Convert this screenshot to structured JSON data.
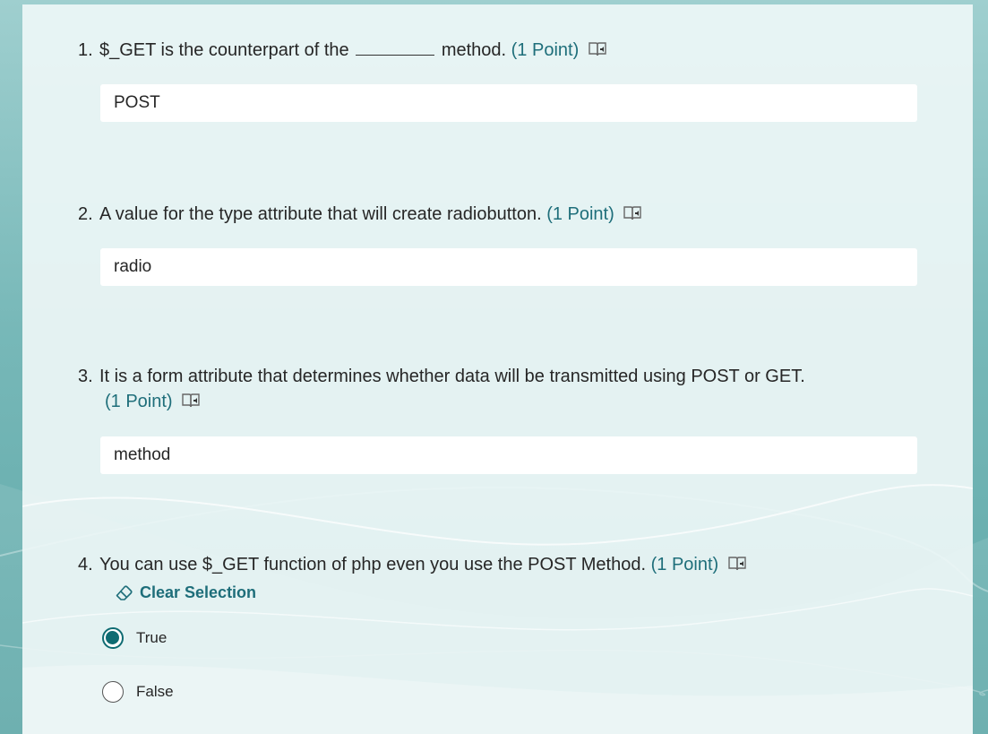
{
  "icons": {
    "read_aloud": "immersive-reader-icon",
    "eraser": "eraser-icon"
  },
  "colors": {
    "accent": "#0f6b72",
    "points": "#1e6e7a",
    "text": "#262626"
  },
  "questions": [
    {
      "number": "1.",
      "text_before": "$_GET is the counterpart of the",
      "text_after": "method.",
      "points": "(1 Point)",
      "answer": "POST"
    },
    {
      "number": "2.",
      "text": "A value for the type attribute that will create radiobutton.",
      "points": "(1 Point)",
      "answer": "radio"
    },
    {
      "number": "3.",
      "text": "It is a form attribute that determines whether data will be transmitted using POST or GET.",
      "points": "(1 Point)",
      "answer": "method"
    },
    {
      "number": "4.",
      "text": "You can use $_GET function of php even you use the POST Method.",
      "points": "(1 Point)",
      "clear_label": "Clear Selection",
      "options": [
        {
          "label": "True",
          "selected": true
        },
        {
          "label": "False",
          "selected": false
        }
      ]
    }
  ]
}
